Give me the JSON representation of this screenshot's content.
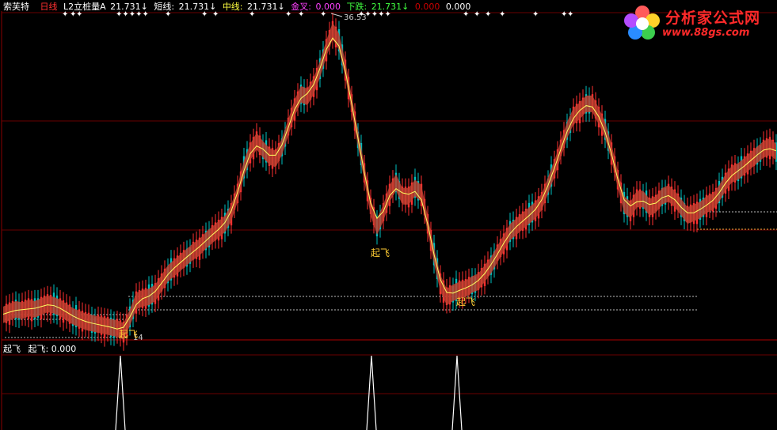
{
  "header": {
    "stock": "索芙特",
    "period": "日线",
    "indicator": "L2立桩量A",
    "a_value": "21.731↓",
    "short_label": "短线:",
    "short_value": "21.731↓",
    "mid_label": "中线:",
    "mid_value": "21.731↓",
    "gold_label": "金叉:",
    "gold_value": "0.000",
    "fall_label": "下跌:",
    "fall_value": "21.731↓",
    "v1": "0.000",
    "v2": "0.000"
  },
  "chart": {
    "peak_label": "36.53",
    "low_label": "14"
  },
  "signals": [
    "起飞",
    "起飞",
    "起飞"
  ],
  "subpanel": {
    "name": "起飞",
    "label": "起飞:",
    "value": "0.000"
  },
  "logo": {
    "title": "分析家公式网",
    "url": "www.88gs.com"
  },
  "colors": {
    "up": "#ff3030",
    "down": "#00c0c0",
    "ribbon": "#c04030",
    "yellow": "#ffff60",
    "gridline": "#7a0000"
  },
  "chart_data": {
    "type": "line",
    "x": [
      0,
      8,
      16,
      24,
      32,
      40,
      48,
      56,
      64,
      72,
      80,
      88,
      96,
      104,
      112,
      120,
      128,
      136,
      144,
      152,
      160,
      168,
      176,
      184,
      192,
      200,
      208,
      216,
      224,
      232,
      240,
      248,
      256,
      264,
      272,
      280,
      288,
      296,
      304,
      312,
      320,
      328,
      336,
      344,
      352,
      360,
      368,
      376,
      384,
      392,
      400,
      408,
      416,
      424,
      432,
      440,
      448,
      456,
      464,
      472,
      480,
      488,
      496,
      504,
      512,
      520,
      528,
      536,
      544,
      552,
      560,
      568,
      576,
      584,
      592,
      600,
      608,
      616,
      624,
      632,
      640,
      648,
      656,
      664,
      672,
      680,
      688,
      696,
      704,
      712,
      720,
      728,
      736,
      744,
      752,
      760,
      768,
      776,
      784,
      792,
      800,
      808,
      816,
      824,
      832,
      840,
      848,
      856,
      864,
      872,
      880,
      888,
      896,
      904,
      912,
      920,
      928,
      936,
      944,
      952,
      960,
      968,
      976
    ],
    "series": [
      {
        "values": [
          15.2,
          15.4,
          15.6,
          15.5,
          15.7,
          15.6,
          15.8,
          16.0,
          15.9,
          15.7,
          15.4,
          15.1,
          14.9,
          14.7,
          14.6,
          14.5,
          14.4,
          14.3,
          14.2,
          14.0,
          15.0,
          16.2,
          16.4,
          16.5,
          16.8,
          17.5,
          18.2,
          18.6,
          19.0,
          19.4,
          19.8,
          20.1,
          20.6,
          21.0,
          21.4,
          21.8,
          22.6,
          24.0,
          25.8,
          27.0,
          27.8,
          27.2,
          26.7,
          26.5,
          27.4,
          28.8,
          30.2,
          31.2,
          31.0,
          31.8,
          33.0,
          34.5,
          35.8,
          35.0,
          33.0,
          30.5,
          28.0,
          25.5,
          23.0,
          21.6,
          22.6,
          24.0,
          24.8,
          23.8,
          23.8,
          24.4,
          24.0,
          21.8,
          19.5,
          17.5,
          16.5,
          16.8,
          17.0,
          17.1,
          17.4,
          17.6,
          18.2,
          18.8,
          19.6,
          20.4,
          21.2,
          21.6,
          22.0,
          22.4,
          22.8,
          23.4,
          24.6,
          25.8,
          27.2,
          28.6,
          29.6,
          30.0,
          30.5,
          30.5,
          29.6,
          28.6,
          27.0,
          25.0,
          23.2,
          22.8,
          23.6,
          23.6,
          23.0,
          23.2,
          23.8,
          24.0,
          23.6,
          23.0,
          22.4,
          22.6,
          22.8,
          23.2,
          23.4,
          24.0,
          24.8,
          25.4,
          25.6,
          26.0,
          26.4,
          26.8,
          27.2,
          27.4,
          27.0
        ]
      }
    ],
    "ylim": [
      13.5,
      37
    ]
  }
}
